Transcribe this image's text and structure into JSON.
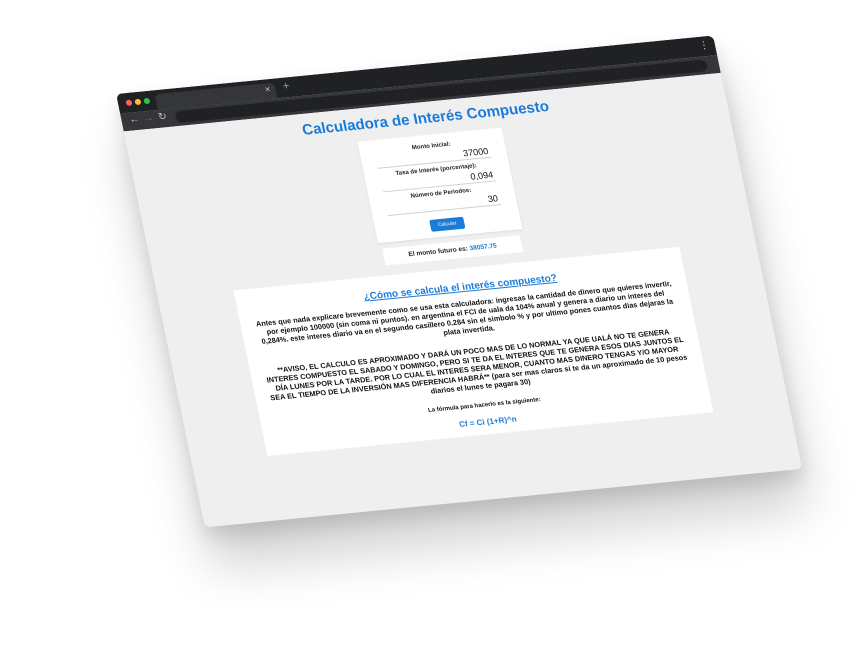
{
  "browser": {
    "tab_close": "×",
    "new_tab": "+",
    "menu": "⋮",
    "back": "←",
    "forward": "→",
    "reload": "↻"
  },
  "page": {
    "title": "Calculadora de Interés Compuesto"
  },
  "form": {
    "initial_label": "Monto Inicial:",
    "initial_value": "37000",
    "rate_label": "Tasa de Interés (porcentaje):",
    "rate_value": "0,094",
    "periods_label": "Número de Periodos:",
    "periods_value": "30",
    "calculate_label": "Calcular"
  },
  "result": {
    "label": "El monto futuro es: ",
    "value": "38057.75"
  },
  "info": {
    "heading": "¿Cómo se calcula el interés compuesto?",
    "paragraph": "Antes que nada explicare brevemente como se usa esta calculadora: ingresas la cantidad de dinero que quieres invertir, por ejemplo 100000 (sin coma ni puntos). en argentina el FCI de uala da 104% anual y genera a diario un interes del 0,284%. este interes diario va en el segundo casillero 0.284 sin el simbolo % y por ultimo pones cuantos dias dejaras la plata invertida.",
    "warning": "**AVISO, EL CALCULO ES APROXIMADO Y DARÁ UN POCO MAS DE LO NORMAL YA QUE UALÁ NO TE GENERA INTERES COMPUESTO EL SABADO Y DOMINGO, PERO SI TE DA EL INTERES QUE TE GENERA ESOS DIAS JUNTOS EL DÍA LUNES POR LA TARDE. POR LO CUAL EL INTERES SERA MENOR, CUANTO MAS DINERO TENGAS Y/O MAYOR SEA EL TIEMPO DE LA INVERSIÓN MAS DIFERENCIA HABRÁ** (para ser mas claros si te da un aproximado de 10 pesos diarios el lunes te pagara 30)",
    "formula_intro": "La fórmula para hacerlo es la siguiente:",
    "formula": "Cf = Ci (1+R)^n"
  },
  "colors": {
    "accent": "#1a7bd8",
    "chrome_dark": "#202124",
    "page_bg": "#efefef"
  }
}
